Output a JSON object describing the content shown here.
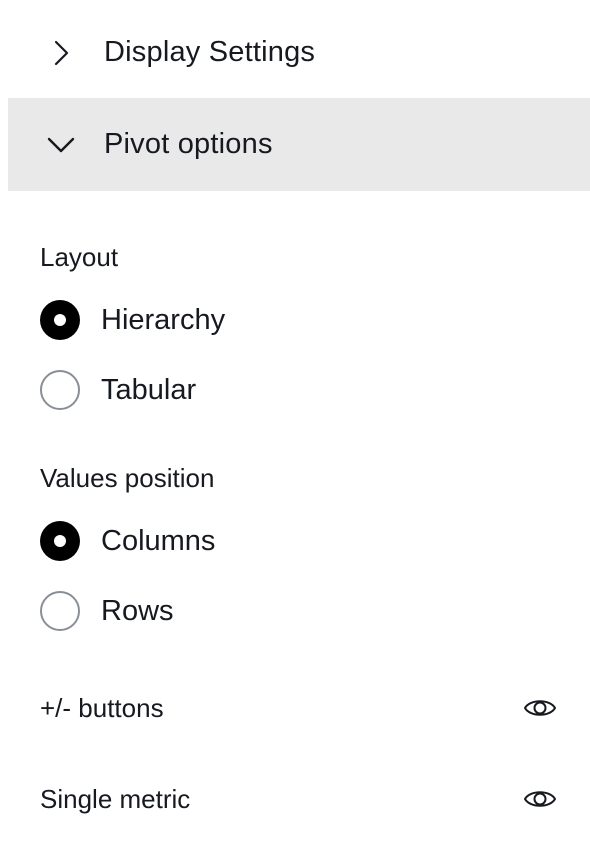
{
  "sections": {
    "display_settings": {
      "label": "Display Settings",
      "expanded": false
    },
    "pivot_options": {
      "label": "Pivot options",
      "expanded": true
    }
  },
  "layout": {
    "label": "Layout",
    "options": [
      {
        "label": "Hierarchy",
        "selected": true
      },
      {
        "label": "Tabular",
        "selected": false
      }
    ]
  },
  "values_position": {
    "label": "Values position",
    "options": [
      {
        "label": "Columns",
        "selected": true
      },
      {
        "label": "Rows",
        "selected": false
      }
    ]
  },
  "toggles": [
    {
      "label": "+/- buttons",
      "icon": "eye-icon",
      "visible": true
    },
    {
      "label": "Single metric",
      "icon": "eye-icon",
      "visible": true
    }
  ],
  "colors": {
    "header_active_bg": "#e9e9e9",
    "text": "#16191f",
    "radio_checked": "#000000",
    "radio_border": "#8a8f97"
  }
}
